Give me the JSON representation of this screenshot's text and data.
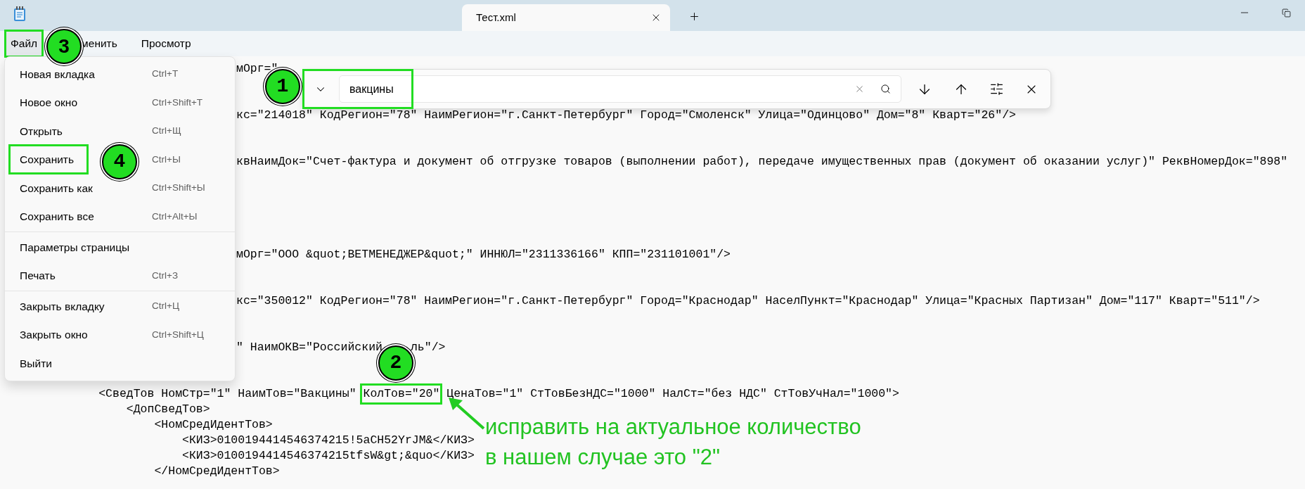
{
  "window": {
    "tab_title": "Тест.xml"
  },
  "menu_bar": [
    {
      "label": "Файл",
      "selected": true,
      "annotated": true,
      "marker": "3"
    },
    {
      "label": "менить",
      "selected": false,
      "annotated": false
    },
    {
      "label": "Просмотр",
      "selected": false,
      "annotated": false
    }
  ],
  "file_menu": {
    "items": [
      {
        "kind": "item",
        "label": "Новая вкладка",
        "shortcut": "Ctrl+T",
        "annotated": false
      },
      {
        "kind": "item",
        "label": "Новое окно",
        "shortcut": "Ctrl+Shift+T",
        "annotated": false
      },
      {
        "kind": "item",
        "label": "Открыть",
        "shortcut": "Ctrl+Щ",
        "annotated": false
      },
      {
        "kind": "item",
        "label": "Сохранить",
        "shortcut": "Ctrl+Ы",
        "annotated": true,
        "marker": "4"
      },
      {
        "kind": "item",
        "label": "Сохранить как",
        "shortcut": "Ctrl+Shift+Ы",
        "annotated": false
      },
      {
        "kind": "item",
        "label": "Сохранить все",
        "shortcut": "Ctrl+Alt+Ы",
        "annotated": false
      },
      {
        "kind": "separator"
      },
      {
        "kind": "item",
        "label": "Параметры страницы",
        "annotated": false
      },
      {
        "kind": "item",
        "label": "Печать",
        "shortcut": "Ctrl+З",
        "annotated": false
      },
      {
        "kind": "separator"
      },
      {
        "kind": "item",
        "label": "Закрыть вкладку",
        "shortcut": "Ctrl+Ц",
        "annotated": false
      },
      {
        "kind": "item",
        "label": "Закрыть окно",
        "shortcut": "Ctrl+Shift+Ц",
        "annotated": false
      },
      {
        "kind": "item",
        "label": "Выйти",
        "annotated": false
      }
    ]
  },
  "find_bar": {
    "query": "вакцины",
    "marker": "1"
  },
  "editor": {
    "lines": [
      {
        "kind": "beside_menu",
        "segments": [
          {
            "text": "мОрг=\""
          }
        ]
      },
      {
        "kind": "covered"
      },
      {
        "kind": "covered"
      },
      {
        "kind": "beside_menu",
        "segments": [
          {
            "text": "кс=\"214018\" КодРегион=\"78\" НаимРегион=\"г.Санкт-Петербург\" Город=\"Смоленск\" Улица=\"Одинцово\" Дом=\"8\" Кварт=\"26\"/>"
          }
        ]
      },
      {
        "kind": "covered"
      },
      {
        "kind": "covered"
      },
      {
        "kind": "beside_menu",
        "segments": [
          {
            "text": "квНаимДок=\"Счет-фактура и документ об отгрузке товаров (выполнении работ), передаче имущественных прав (документ об оказании услуг)\" РеквНомерДок=\"898\""
          }
        ]
      },
      {
        "kind": "covered"
      },
      {
        "kind": "covered"
      },
      {
        "kind": "covered"
      },
      {
        "kind": "covered"
      },
      {
        "kind": "covered"
      },
      {
        "kind": "beside_menu",
        "segments": [
          {
            "text": "мОрг=\"ООО &quot;ВЕТМЕНЕДЖЕР&quot;\" ИННЮЛ=\"2311336166\" КПП=\"231101001\"/>"
          }
        ]
      },
      {
        "kind": "covered"
      },
      {
        "kind": "covered"
      },
      {
        "kind": "beside_menu",
        "segments": [
          {
            "text": "кс=\"350012\" КодРегион=\"78\" НаимРегион=\"г.Санкт-Петербург\" Город=\"Краснодар\" НаселПункт=\"Краснодар\" Улица=\"Красных Партизан\" Дом=\"117\" Кварт=\"511\"/>"
          }
        ]
      },
      {
        "kind": "covered"
      },
      {
        "kind": "covered"
      },
      {
        "kind": "beside_menu",
        "segments": [
          {
            "text": "\" НаимОКВ=\"Российский"
          },
          {
            "text": "ль\"/>"
          }
        ]
      },
      {
        "kind": "covered"
      },
      {
        "kind": "covered"
      },
      {
        "kind": "full",
        "segments": [
          {
            "text": "        <СведТов НомСтр=\"1\" НаимТов=\"Вакцины\" "
          },
          {
            "text": "КолТов=\"20\"",
            "annotated": true,
            "marker": "2"
          },
          {
            "text": " ЦенаТов=\"1\" СтТовБезНДС=\"1000\" НалСт=\"без НДС\" СтТовУчНал=\"1000\">"
          }
        ]
      },
      {
        "kind": "full",
        "segments": [
          {
            "text": "            <ДопСведТов>"
          }
        ]
      },
      {
        "kind": "full",
        "segments": [
          {
            "text": "                <НомСредИдентТов>"
          }
        ]
      },
      {
        "kind": "full",
        "segments": [
          {
            "text": "                    <КИЗ>0100194414546374215!5aCH52YrJM&</КИЗ>"
          }
        ]
      },
      {
        "kind": "full",
        "segments": [
          {
            "text": "                    <КИЗ>0100194414546374215tfsW&gt;&quo</КИЗ>"
          }
        ]
      },
      {
        "kind": "full",
        "segments": [
          {
            "text": "                </НомСредИдентТов>"
          }
        ]
      }
    ]
  },
  "note": [
    "исправить на актуальное количество",
    "в нашем случае это \"2\""
  ]
}
